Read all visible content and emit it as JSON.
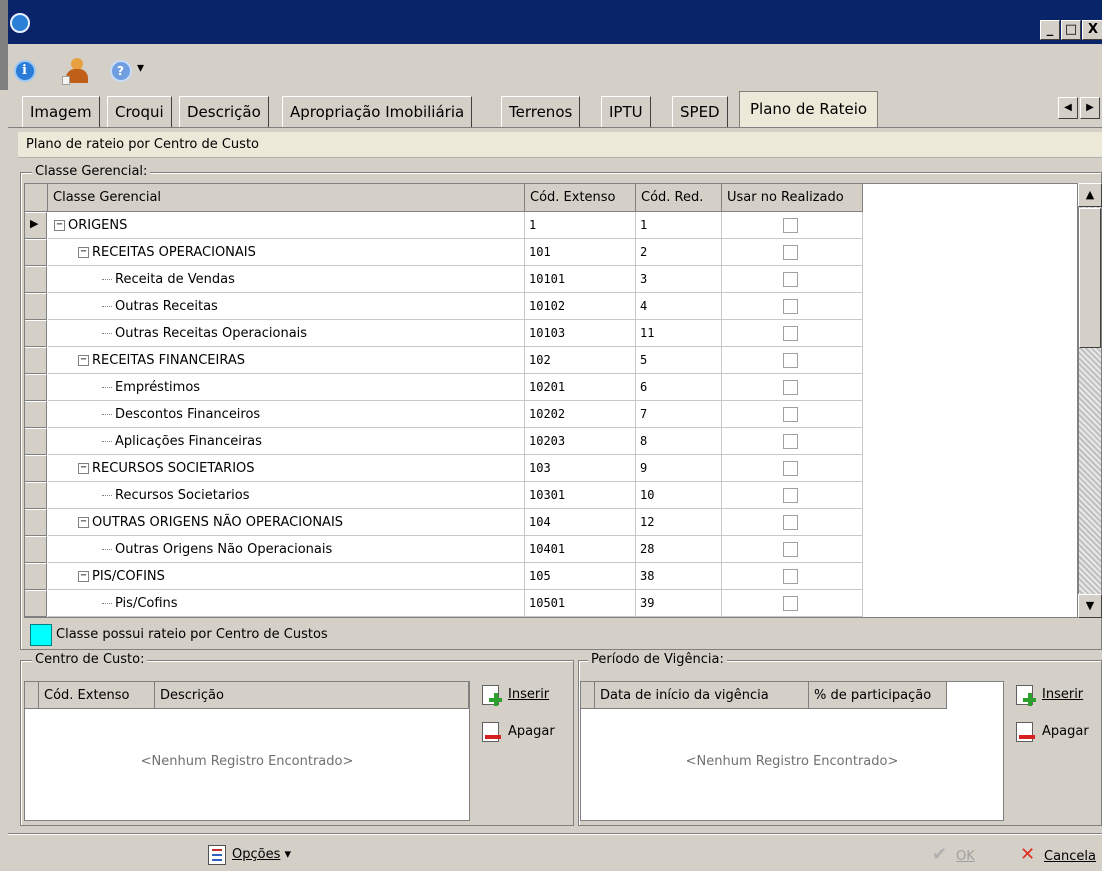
{
  "window": {
    "title": "",
    "controls": {
      "minimize": "_",
      "maximize": "□",
      "close": "X"
    }
  },
  "toolbar": {
    "icons": [
      "info-icon",
      "user-icon",
      "help-icon"
    ],
    "dropdown_arrow": "▾"
  },
  "tabs": [
    {
      "label": "Imagem",
      "active": false
    },
    {
      "label": "Croqui",
      "active": false
    },
    {
      "label": "Descrição",
      "active": false
    },
    {
      "label": "Apropriação Imobiliária",
      "active": false
    },
    {
      "label": "Terrenos",
      "active": false
    },
    {
      "label": "IPTU",
      "active": false
    },
    {
      "label": "SPED",
      "active": false
    },
    {
      "label": "Plano de Rateio",
      "active": true
    }
  ],
  "tab_nav": {
    "prev": "◀",
    "next": "▶"
  },
  "page": {
    "header": "Plano de rateio por Centro de Custo",
    "classe_group_label": "Classe Gerencial:",
    "grid": {
      "columns": [
        "Classe Gerencial",
        "Cód. Extenso",
        "Cód. Red.",
        "Usar no Realizado"
      ],
      "rows": [
        {
          "label": "ORIGENS",
          "level": 0,
          "node": "expanded",
          "ext": "1",
          "red": "1",
          "current": true
        },
        {
          "label": "RECEITAS OPERACIONAIS",
          "level": 1,
          "node": "expanded",
          "ext": "101",
          "red": "2"
        },
        {
          "label": "Receita de Vendas",
          "level": 2,
          "node": "leaf",
          "ext": "10101",
          "red": "3"
        },
        {
          "label": "Outras Receitas",
          "level": 2,
          "node": "leaf",
          "ext": "10102",
          "red": "4"
        },
        {
          "label": "Outras Receitas Operacionais",
          "level": 2,
          "node": "leaf",
          "ext": "10103",
          "red": "11"
        },
        {
          "label": "RECEITAS FINANCEIRAS",
          "level": 1,
          "node": "expanded",
          "ext": "102",
          "red": "5"
        },
        {
          "label": "Empréstimos",
          "level": 2,
          "node": "leaf",
          "ext": "10201",
          "red": "6"
        },
        {
          "label": "Descontos Financeiros",
          "level": 2,
          "node": "leaf",
          "ext": "10202",
          "red": "7"
        },
        {
          "label": "Aplicações Financeiras",
          "level": 2,
          "node": "leaf",
          "ext": "10203",
          "red": "8"
        },
        {
          "label": "RECURSOS SOCIETARIOS",
          "level": 1,
          "node": "expanded",
          "ext": "103",
          "red": "9"
        },
        {
          "label": "Recursos Societarios",
          "level": 2,
          "node": "leaf",
          "ext": "10301",
          "red": "10"
        },
        {
          "label": "OUTRAS ORIGENS NÃO OPERACIONAIS",
          "level": 1,
          "node": "expanded",
          "ext": "104",
          "red": "12"
        },
        {
          "label": "Outras Origens Não Operacionais",
          "level": 2,
          "node": "leaf",
          "ext": "10401",
          "red": "28"
        },
        {
          "label": "PIS/COFINS",
          "level": 1,
          "node": "expanded",
          "ext": "105",
          "red": "38"
        },
        {
          "label": "Pis/Cofins",
          "level": 2,
          "node": "leaf",
          "ext": "10501",
          "red": "39"
        }
      ]
    },
    "rateio_legend": "Classe possui rateio por Centro de Custos",
    "rateio_color": "#00ffff"
  },
  "centro_custo": {
    "label": "Centro de Custo:",
    "columns": [
      "Cód. Extenso",
      "Descrição"
    ],
    "empty": "<Nenhum Registro Encontrado>",
    "insert": "Inserir",
    "delete": "Apagar"
  },
  "vigencia": {
    "label": "Período de Vigência:",
    "columns": [
      "Data de início da vigência",
      "% de participação"
    ],
    "empty": "<Nenhum Registro Encontrado>",
    "insert": "Inserir",
    "delete": "Apagar"
  },
  "statusbar": {
    "options": "Opções",
    "ok": "OK",
    "cancel": "Cancela"
  }
}
